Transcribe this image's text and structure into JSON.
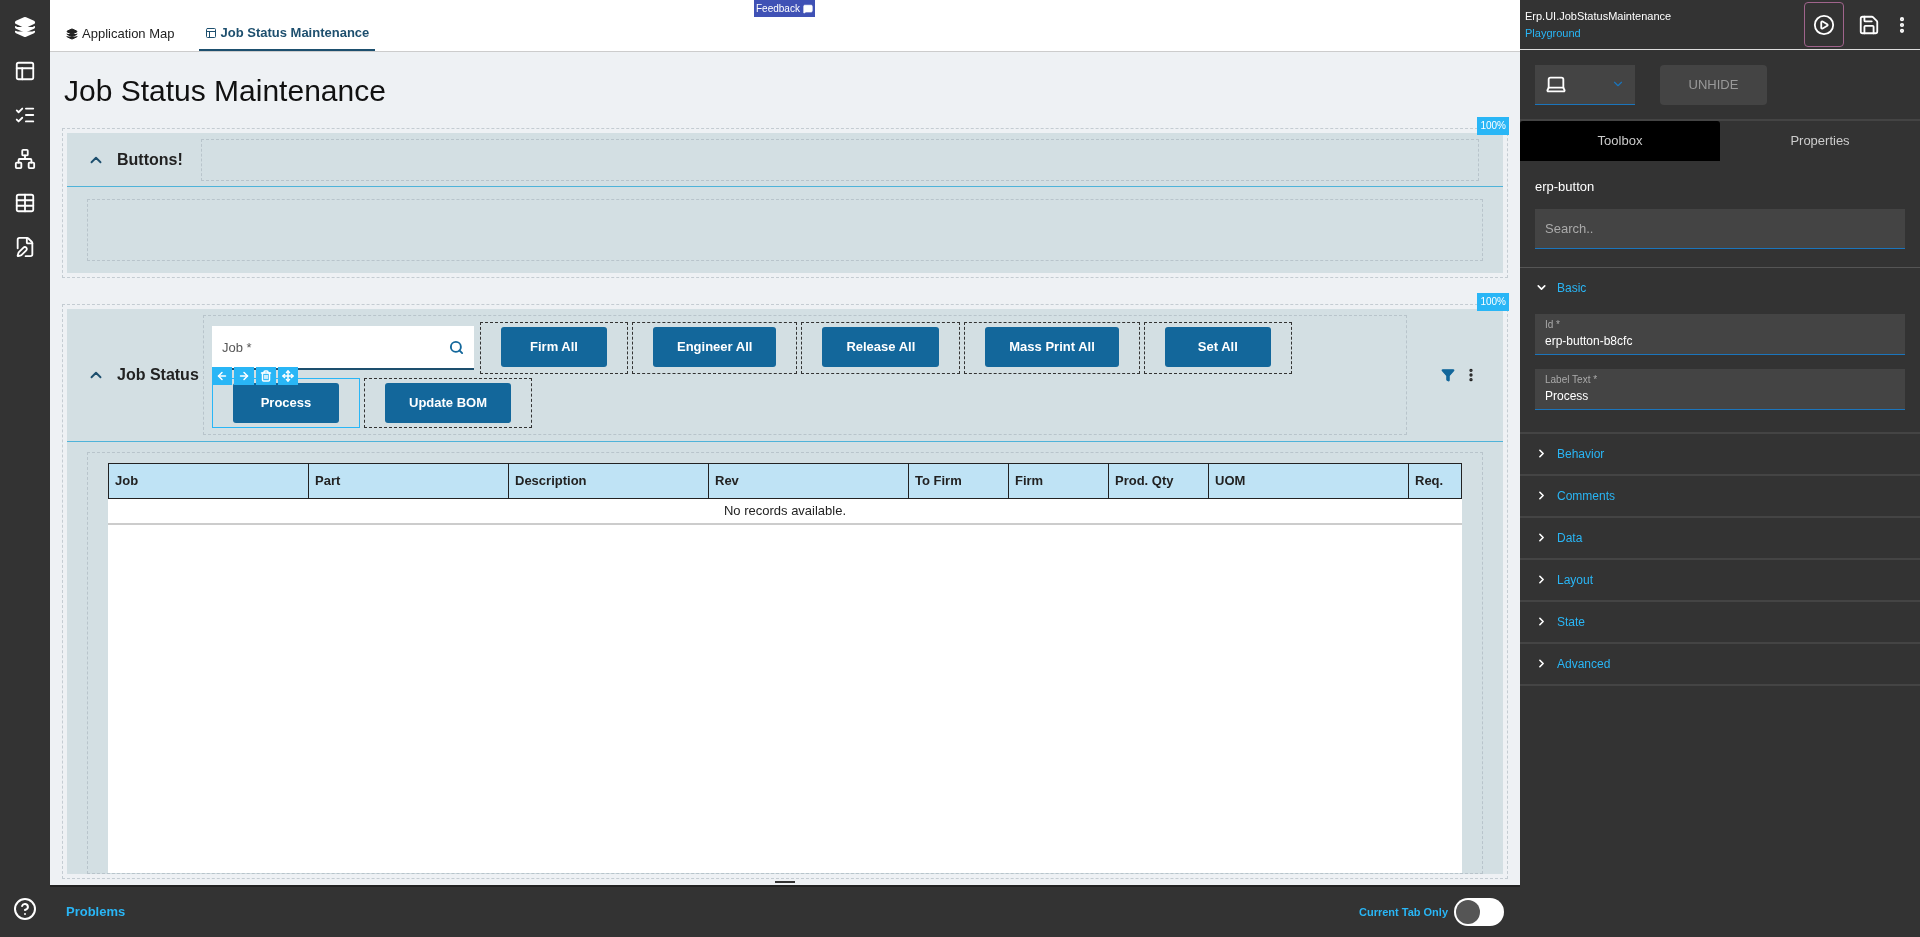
{
  "tabs": [
    {
      "label": "Application Map",
      "selected": false
    },
    {
      "label": "Job Status Maintenance",
      "selected": true
    }
  ],
  "feedback": "Feedback",
  "page_title": "Job Status Maintenance",
  "panels": [
    {
      "kind": "empty",
      "title": "Buttons!",
      "zoom": "100%",
      "expanded": true
    },
    {
      "kind": "grid",
      "title": "Job Status",
      "zoom": "100%",
      "expanded": true,
      "field": {
        "placeholder": "Job *"
      },
      "buttons": [
        {
          "label": "Firm All",
          "selected": false
        },
        {
          "label": "Engineer All",
          "selected": false
        },
        {
          "label": "Release All",
          "selected": false
        },
        {
          "label": "Mass Print All",
          "selected": false
        },
        {
          "label": "Set All",
          "selected": false
        },
        {
          "label": "Process",
          "selected": true
        },
        {
          "label": "Update BOM",
          "selected": false
        }
      ],
      "columns": [
        "Job",
        "Part",
        "Description",
        "Rev",
        "To Firm",
        "Firm",
        "Prod. Qty",
        "UOM",
        "Req."
      ],
      "empty_message": "No records available."
    }
  ],
  "designer": {
    "title": "Erp.UI.JobStatusMaintenance",
    "subtitle": "Playground",
    "unhide": "UNHIDE",
    "tabs": [
      {
        "label": "Toolbox",
        "selected": true
      },
      {
        "label": "Properties",
        "selected": false
      }
    ],
    "component": "erp-button",
    "search": {
      "placeholder": "Search.."
    },
    "sections": [
      {
        "title": "Basic",
        "expanded": true,
        "fields": [
          {
            "label": "Id *",
            "value": "erp-button-b8cfc"
          },
          {
            "label": "Label Text *",
            "value": "Process"
          }
        ]
      },
      {
        "title": "Behavior",
        "expanded": false
      },
      {
        "title": "Comments",
        "expanded": false
      },
      {
        "title": "Data",
        "expanded": false
      },
      {
        "title": "Layout",
        "expanded": false
      },
      {
        "title": "State",
        "expanded": false
      },
      {
        "title": "Advanced",
        "expanded": false
      }
    ]
  },
  "bottom": {
    "problems": "Problems",
    "toggle": {
      "label": "Current Tab Only",
      "on": false
    }
  }
}
